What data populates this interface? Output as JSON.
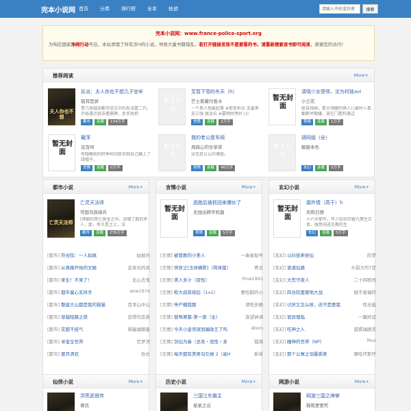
{
  "header": {
    "logo": "完本小说网",
    "nav": [
      "首页",
      "分类",
      "排行榜",
      "全本",
      "轨迹"
    ],
    "search_placeholder": "请输入书名或作者",
    "search_button": "搜索"
  },
  "notice": {
    "site_label": "完本小说网：",
    "site_url": "www.france-police-sport.org",
    "text_1": "为响应国家",
    "text_bold_1": "净网行动",
    "text_2": "号召，本站清理了所有涉H的小说，导致大量书籍错乱，",
    "text_bold_2": "若打开链接发现不是要看的书，请重新搜索该书即可阅读",
    "text_3": "，感谢您的访问！"
  },
  "recommend": {
    "title": "推荐阅读",
    "more": "More+",
    "books": [
      {
        "title": "反派：夫人你也不想几子坐牢",
        "author": "猫耳是屏",
        "desc": "青几穿越成都市冠文中的反派富二代，开局遇点就去撸豪牌，反手就把",
        "tags": [
          "都市",
          "连载",
          "134万字"
        ],
        "cover": "real",
        "cover_text": "夫人你也不想"
      },
      {
        "title": "至暂下雪的冬天（h）",
        "author": "芒士紫藏付香水",
        "desc": "一个男人想要赶事 #周星析站 无要男 无三强 强龙坑 #要明时停好 |小",
        "tags": [
          "言情",
          "连载",
          "3万字"
        ],
        "cover": "ph",
        "cover_text": "暂无封面"
      },
      {
        "title": "清晓少女受师、沦为村妓avi",
        "author": "小兰花",
        "desc": "耿自钱她，那大领腰的俩人儿被村人看都薪并期嫌，放在门看料路边",
        "tags": [
          "首情",
          "连载",
          "1万字"
        ],
        "cover": "ph2",
        "cover_text": "暂无封面"
      },
      {
        "title": "寵浑",
        "author": "吉百呀",
        "desc": "有隐瞒他的阿季和切练手腕自己藏上了绿帽子。",
        "tags": [
          "言情",
          "连载",
          "0万字"
        ],
        "cover": "ph2",
        "cover_text": "暂无封面"
      },
      {
        "title": "我的老公是军阀",
        "author": "周鹃心的甘草草",
        "desc": "张宝是公认的傻姐。",
        "tags": [
          "首情",
          "连载",
          "46万字"
        ],
        "cover": "ph",
        "cover_text": "暂无封面"
      },
      {
        "title": "胡同组（全）",
        "author": "靓服本色",
        "desc": "",
        "tags": [
          "玄幻",
          "连载",
          "5万字"
        ],
        "cover": "ph",
        "cover_text": "暂无封面"
      }
    ]
  },
  "categories": [
    {
      "title": "都市小说",
      "more": "More+",
      "feat": {
        "title": "亡灵天法师",
        "author": "帝国鸟族骑兵",
        "desc": "[神龍的死亡营里之中，迎嗖了数的黑人，那，帝王是之上，法",
        "tags": [
          "都市",
          "连载",
          "276万字"
        ],
        "cover_text": "亡灵天法师"
      },
      "items": [
        {
          "cat": "[都市]",
          "name": "符合院：一人拟飒",
          "author": "姑娘共"
        },
        {
          "cat": "[都市]",
          "name": "从离婚开始的文娱",
          "author": "会发光的风"
        },
        {
          "cat": "[都市]",
          "name": "来生！不来了！",
          "author": "无心去鬼"
        },
        {
          "cat": "[都市]",
          "name": "都市偏心玄所手",
          "author": "wtw1974"
        },
        {
          "cat": "[都市]",
          "name": "整座大山都是我的猫猫",
          "author": "百李山中山"
        },
        {
          "cat": "[都市]",
          "name": "穿越短路之旅",
          "author": "您得的态表"
        },
        {
          "cat": "[都市]",
          "name": "花都不挂气",
          "author": "隔着塘朝墨"
        },
        {
          "cat": "[都市]",
          "name": "寻宝全世界",
          "author": "尼罗河"
        },
        {
          "cat": "[都市]",
          "name": "罢月清欢",
          "author": "怡长"
        }
      ]
    },
    {
      "title": "言情小说",
      "more": "More+",
      "feat": {
        "title": "逃跑后被抓回来爆炒了",
        "author": "无恤出碑字机器",
        "desc": "",
        "tags": [
          "首情",
          "连载",
          "5万字"
        ],
        "cover_text": "暂无封面"
      },
      "items": [
        {
          "cat": "[言情]",
          "name": "被管教的小美人",
          "author": "一串省船号"
        },
        {
          "cat": "[言情]",
          "name": "快穿之[玉体横陈]（简体版）",
          "author": "青旦"
        },
        {
          "cat": "[言情]",
          "name": "美人多汁（双性）",
          "author": "fmw1991"
        },
        {
          "cat": "[言情]",
          "name": "和大叔奔现后（1v1）",
          "author": "要吃鹅的小"
        },
        {
          "cat": "[言情]",
          "name": "亭产模錯题",
          "author": "请吃安静"
        },
        {
          "cat": "[言情]",
          "name": "替莺寒篇-第一部（全）",
          "author": "涟望钟调"
        },
        {
          "cat": "[言情]",
          "name": "今天小皇帝哭到踊政王了吗",
          "author": "Atom"
        },
        {
          "cat": "[言情]",
          "name": "剑仙为妾（总攻・双性・多",
          "author": "我瑛"
        },
        {
          "cat": "[言情]",
          "name": "每天都有美男勾引她 2（高H",
          "author": "新将"
        }
      ]
    },
    {
      "title": "玄幻小说",
      "more": "More+",
      "feat": {
        "title": "婚外情（高干）h",
        "author": "风和日丽",
        "desc": "十六岁那年，年少轻狂的留九情生正审，强势闯进正教的生",
        "tags": [
          "玄幻",
          "连载",
          "5万字"
        ],
        "cover_text": "暂无封面"
      },
      "items": [
        {
          "cat": "[玄幻]",
          "name": "以抖技来修仙",
          "author": "陀梦"
        },
        {
          "cat": "[玄幻]",
          "name": "诡道仙路",
          "author": "头裂大的T官"
        },
        {
          "cat": "[玄幻]",
          "name": "大荒守夜人",
          "author": "二十四桥闯"
        },
        {
          "cat": "[玄幻]",
          "name": "四合院里聚地大战",
          "author": "微不香瑞的"
        },
        {
          "cat": "[玄幻]",
          "name": "讨厌又怎么样，还不是要我",
          "author": "性无能"
        },
        {
          "cat": "[玄幻]",
          "name": "诡异理临",
          "author": "一藏好运"
        },
        {
          "cat": "[玄幻]",
          "name": "吃神之人",
          "author": "甜撰瑞跟求"
        },
        {
          "cat": "[玄幻]",
          "name": "睡神的世界（NP）",
          "author": "Mus"
        },
        {
          "cat": "[玄幻]",
          "name": "那个公寓之羽暴裘来",
          "author": "摩吃坏斯坏"
        }
      ]
    }
  ],
  "bottom": [
    {
      "title": "仙侠小说",
      "more": "More+",
      "feat_title": "洪荒武祖传",
      "feat_author": "佛良"
    },
    {
      "title": "历史小说",
      "more": "More+",
      "feat_title": "三国江东霸主",
      "feat_author": "星星之云"
    },
    {
      "title": "网游小说",
      "more": "More+",
      "feat_title": "网游三国之神掌",
      "feat_author": "猫昵更更死"
    }
  ]
}
